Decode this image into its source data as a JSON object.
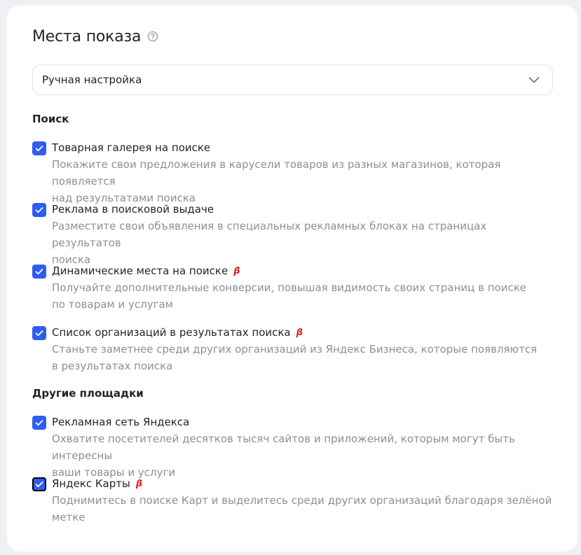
{
  "header": {
    "title": "Места показа"
  },
  "mode_select": {
    "value": "Ручная настройка"
  },
  "sections": {
    "search": {
      "title": "Поиск",
      "options": [
        {
          "label": "Товарная галерея на поиске",
          "desc_line1": "Покажите свои предложения в карусели товаров из разных магазинов, которая появляется",
          "desc_line2": "над результатами поиска",
          "beta": "",
          "checked": true
        },
        {
          "label": "Реклама в поисковой выдаче",
          "desc_line1": "Разместите свои объявления в специальных рекламных блоках на страницах результатов",
          "desc_line2": "поиска",
          "beta": "",
          "checked": true
        },
        {
          "label": "Динамические места на поиске",
          "desc_line1": "Получайте дополнительные конверсии, повышая видимость своих страниц в поиске",
          "desc_line2": "по товарам и услугам",
          "beta": "β",
          "checked": true
        },
        {
          "label": "Список организаций в результатах поиска",
          "desc_line1": "Станьте заметнее среди других организаций из Яндекс Бизнеса, которые появляются",
          "desc_line2": "в результатах поиска",
          "beta": "β",
          "checked": true
        }
      ]
    },
    "other": {
      "title": "Другие площадки",
      "options": [
        {
          "label": "Рекламная сеть Яндекса",
          "desc_line1": "Охватите посетителей десятков тысяч сайтов и приложений, которым могут быть интересны",
          "desc_line2": "ваши товары и услуги",
          "beta": "",
          "checked": true
        },
        {
          "label": "Яндекс Карты",
          "desc_line1": "Поднимитесь в поиске Карт и выделитесь среди других организаций благодаря зелёной",
          "desc_line2": "метке",
          "beta": "β",
          "checked": true
        }
      ]
    }
  },
  "icons": {
    "help": "question-circle-icon",
    "chevron": "chevron-down-icon",
    "check": "checkmark-icon"
  },
  "colors": {
    "accent": "#2f5cf2",
    "beta": "#e0191d",
    "muted_text": "#8b8f99"
  }
}
